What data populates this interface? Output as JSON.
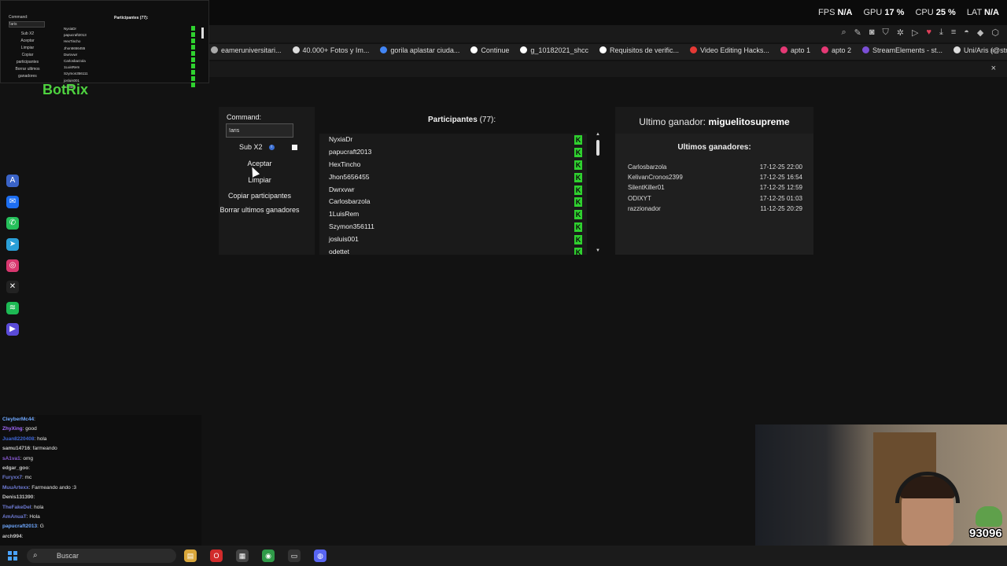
{
  "stats": {
    "fps_label": "FPS",
    "fps_value": "N/A",
    "gpu_label": "GPU",
    "gpu_value": "17 %",
    "cpu_label": "CPU",
    "cpu_value": "25 %",
    "lat_label": "LAT",
    "lat_value": "N/A"
  },
  "bookmarks": [
    "eameruniversitari...",
    "40.000+ Fotos y Im...",
    "gorila aplastar ciuda...",
    "Continue",
    "g_10182021_shcc",
    "Requisitos de verific...",
    "Video Editing Hacks...",
    "apto 1",
    "apto 2",
    "StreamElements - st...",
    "Uni/Aris (@streame..."
  ],
  "bookmark_more": "»",
  "notify_close": "×",
  "logo": "BotRix",
  "command": {
    "label": "Command:",
    "value": "!aris",
    "sub_label": "Sub X2",
    "accept_label": "Aceptar",
    "clear_label": "Limpiar",
    "copy_label": "Copiar participantes",
    "delete_label": "Borrar ultimos ganadores"
  },
  "participants": {
    "title": "Participantes",
    "count": "(77):",
    "kick_glyph": "K",
    "scroll_up": "▲",
    "scroll_down": "▼",
    "names": [
      "NyxiaDr",
      "papucraft2013",
      "HexTincho",
      "Jhon5656455",
      "Dwrxvwr",
      "Carlosbarzola",
      "1LuisRem",
      "Szymon356111",
      "josluis001",
      "odettet"
    ]
  },
  "winners": {
    "last_label": "Ultimo ganador:",
    "last_name": "miguelitosupreme",
    "heading": "Ultimos ganadores:",
    "list": [
      {
        "name": "Carlosbarzola",
        "date": "17-12-25 22:00"
      },
      {
        "name": "KelivanCronos2399",
        "date": "17-12-25 16:54"
      },
      {
        "name": "SilentKiller01",
        "date": "17-12-25 12:59"
      },
      {
        "name": "ODIXYT",
        "date": "17-12-25 01:03"
      },
      {
        "name": "razzionador",
        "date": "11-12-25 20:29"
      }
    ]
  },
  "chat": [
    {
      "user": "CleyberMc44",
      "msg": ": ",
      "color": "#6fa8ff"
    },
    {
      "user": "ZhyXing",
      "msg": ": good",
      "color": "#a56bff"
    },
    {
      "user": "Juan8220408",
      "msg": ": hola",
      "color": "#3f66d6"
    },
    {
      "user": "samu14716",
      "msg": ": farmeando",
      "color": "#c8c8c8"
    },
    {
      "user": "sA1va1",
      "msg": ": omg",
      "color": "#8b5bd6"
    },
    {
      "user": "edgar_goo",
      "msg": ": ",
      "color": "#c8c8c8"
    },
    {
      "user": "Furyxx7",
      "msg": ": mc",
      "color": "#6f7cd6"
    },
    {
      "user": "MuuArtexx",
      "msg": ": Farmeando ando :3",
      "color": "#6f7cd6"
    },
    {
      "user": "Denis131390",
      "msg": ": ",
      "color": "#c8c8c8"
    },
    {
      "user": "TheFakeDel",
      "msg": ": hola",
      "color": "#6f7cd6"
    },
    {
      "user": "AmAnuaT",
      "msg": ": Hola",
      "color": "#6f7cd6"
    },
    {
      "user": "papucraft2013",
      "msg": ": G",
      "color": "#6fa8ff"
    },
    {
      "user": "arch994",
      "msg": ": ",
      "color": "#c8c8c8"
    }
  ],
  "webcam_badge": "93096",
  "taskbar": {
    "search_placeholder": "Buscar"
  },
  "colors": {
    "accent_green": "#2fd12f",
    "logo_green": "#4ed23f",
    "panel_bg": "#1a1a1a"
  }
}
